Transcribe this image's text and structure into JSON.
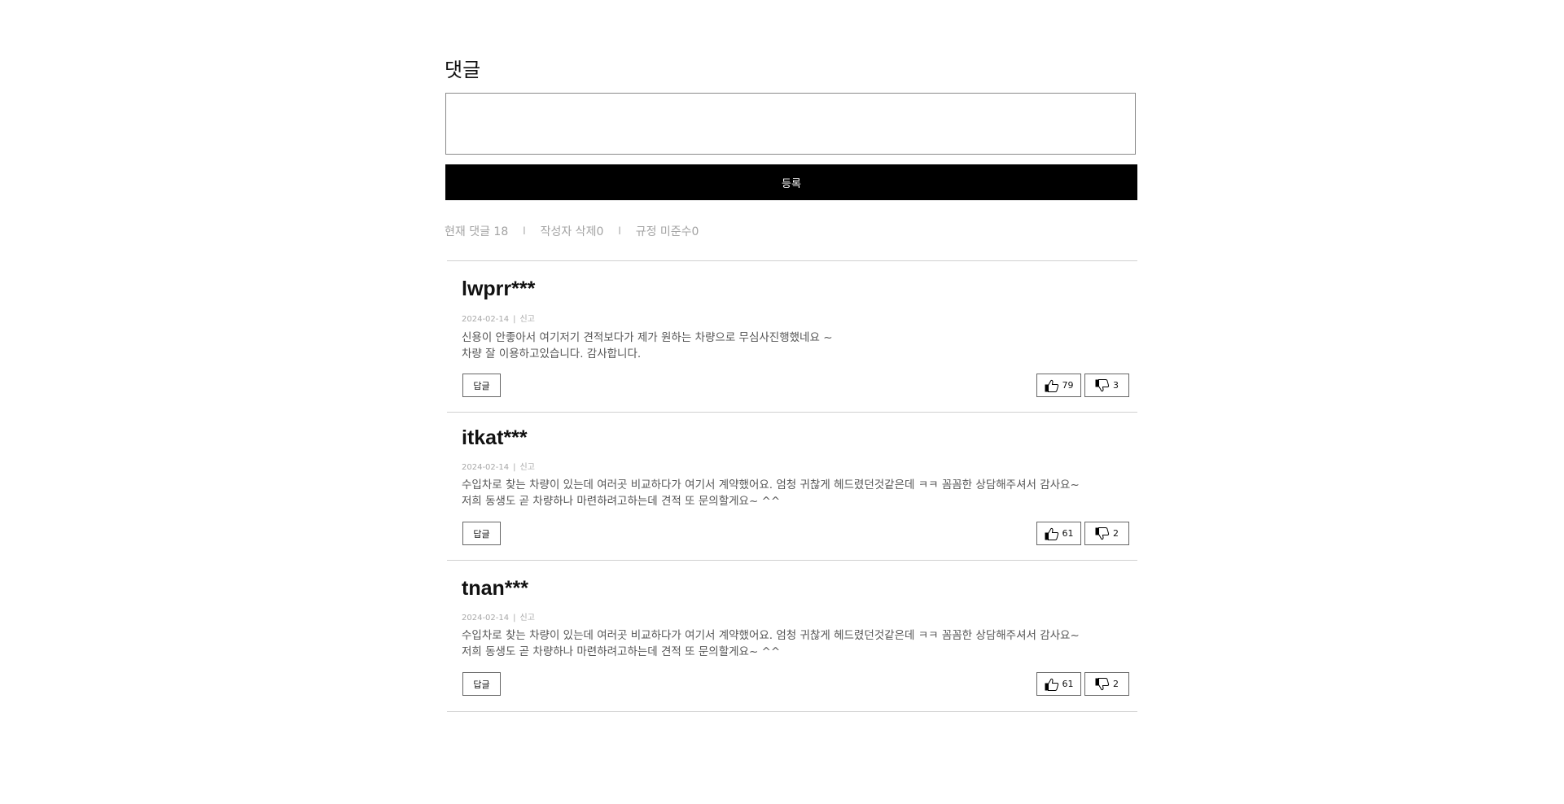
{
  "section": {
    "title": "댓글"
  },
  "form": {
    "input_value": "",
    "input_placeholder": "",
    "submit_label": "등록"
  },
  "stats": {
    "current": "현재 댓글 18",
    "deleted_by_author": "작성자 삭제0",
    "rule_violation": "규정 미준수0",
    "separator": "l"
  },
  "comments": [
    {
      "username": "lwprr***",
      "date": "2024-02-14",
      "meta_sep": "|",
      "report_label": "신고",
      "lines": [
        "신용이 안좋아서 여기저기 견적보다가 제가 원하는 차량으로 무심사진행했네요 ~",
        "차량 잘 이용하고있습니다. 감사합니다."
      ],
      "reply_label": "답글",
      "likes": "79",
      "dislikes": "3"
    },
    {
      "username": "itkat***",
      "date": "2024-02-14",
      "meta_sep": "|",
      "report_label": "신고",
      "lines": [
        "수입차로 찾는 차량이 있는데 여러곳 비교하다가 여기서 계약했어요. 엄청 귀찮게 헤드렸던것같은데 ㅋㅋ 꼼꼼한 상담해주셔서 감사요~",
        "저희 동생도 곧 차량하나 마련하려고하는데 견적 또 문의할게요~ ^^"
      ],
      "reply_label": "답글",
      "likes": "61",
      "dislikes": "2"
    },
    {
      "username": "tnan***",
      "date": "2024-02-14",
      "meta_sep": "|",
      "report_label": "신고",
      "lines": [
        "수입차로 찾는 차량이 있는데 여러곳 비교하다가 여기서 계약했어요. 엄청 귀찮게 헤드렸던것같은데 ㅋㅋ 꼼꼼한 상담해주셔서 감사요~",
        "저희 동생도 곧 차량하나 마련하려고하는데 견적 또 문의할게요~ ^^"
      ],
      "reply_label": "답글",
      "likes": "61",
      "dislikes": "2"
    }
  ],
  "icons": {
    "like": "thumbs-up-icon",
    "dislike": "thumbs-down-icon"
  },
  "colors": {
    "button_bg": "#000000",
    "button_text": "#ffffff",
    "muted_text": "#a3a3a3",
    "border": "#666666"
  }
}
